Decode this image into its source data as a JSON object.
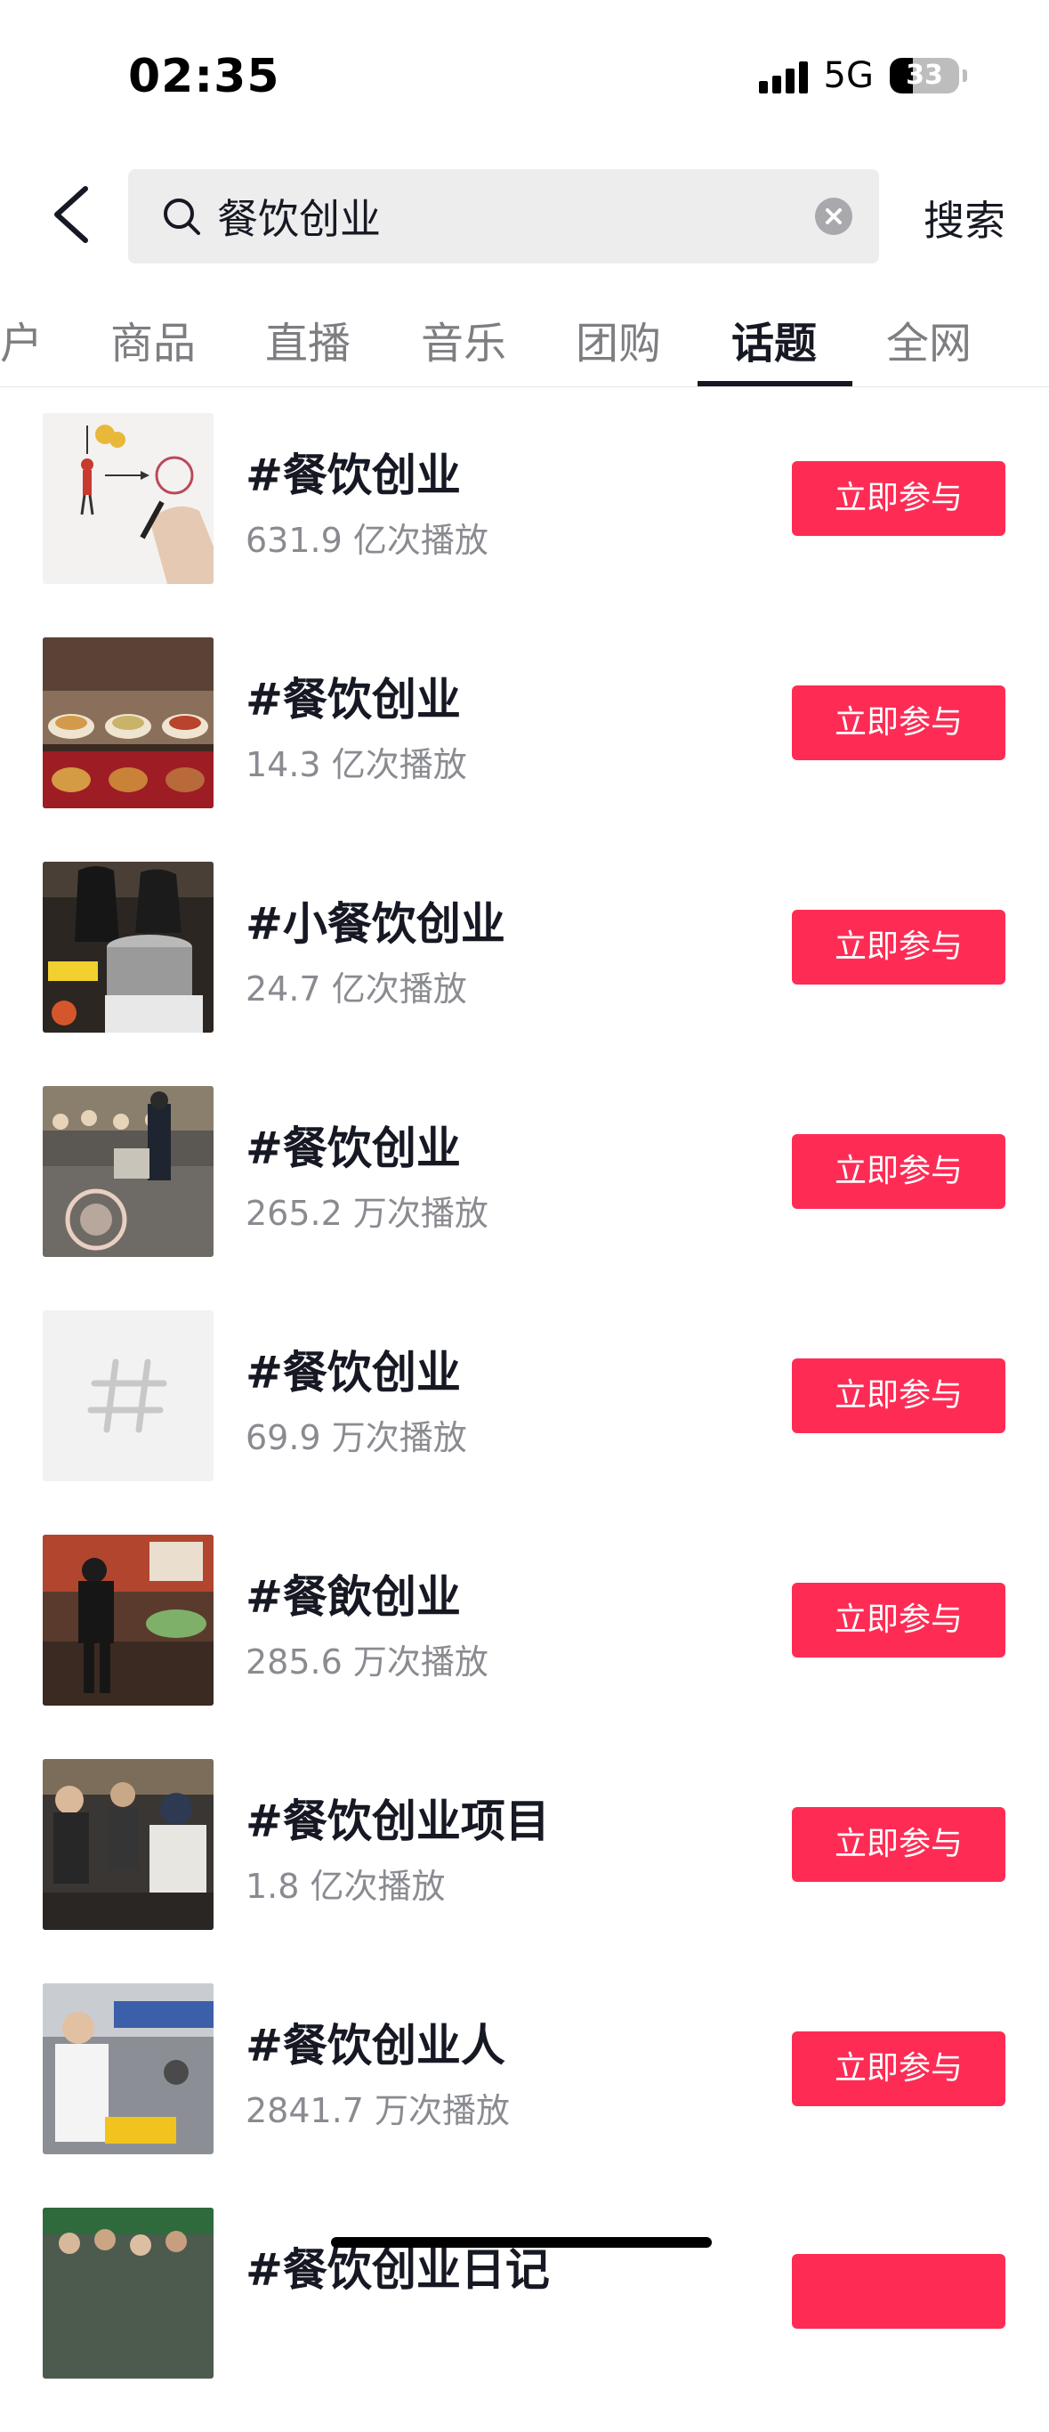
{
  "status_bar": {
    "time": "02:35",
    "network": "5G",
    "battery": "33",
    "battery_level": 0.33
  },
  "search": {
    "value": "餐饮创业",
    "submit_label": "搜索"
  },
  "tabs": [
    {
      "label": "户",
      "active": false
    },
    {
      "label": "商品",
      "active": false
    },
    {
      "label": "直播",
      "active": false
    },
    {
      "label": "音乐",
      "active": false
    },
    {
      "label": "团购",
      "active": false
    },
    {
      "label": "话题",
      "active": true
    },
    {
      "label": "全网",
      "active": false
    }
  ],
  "topics": [
    {
      "title": "#餐饮创业",
      "plays": "631.9 亿次播放",
      "button": "立即参与",
      "thumb": "drawing-pen"
    },
    {
      "title": "#餐饮创业",
      "plays": "14.3 亿次播放",
      "button": "立即参与",
      "thumb": "noodle-menu"
    },
    {
      "title": "#小餐饮创业",
      "plays": "24.7 亿次播放",
      "button": "立即参与",
      "thumb": "kitchen-pot"
    },
    {
      "title": "#餐饮创业",
      "plays": "265.2 万次播放",
      "button": "立即参与",
      "thumb": "street-crowd"
    },
    {
      "title": "#餐饮创业",
      "plays": "69.9 万次播放",
      "button": "立即参与",
      "thumb": "hashtag-placeholder"
    },
    {
      "title": "#餐飲创业",
      "plays": "285.6 万次播放",
      "button": "立即参与",
      "thumb": "shop-counter"
    },
    {
      "title": "#餐饮创业项目",
      "plays": "1.8 亿次播放",
      "button": "立即参与",
      "thumb": "people-queue"
    },
    {
      "title": "#餐饮创业人",
      "plays": "2841.7 万次播放",
      "button": "立即参与",
      "thumb": "street-vendor"
    },
    {
      "title": "#餐饮创业日记",
      "plays": "",
      "button": "",
      "thumb": "market-crowd"
    }
  ],
  "colors": {
    "accent": "#fe2c55",
    "text_primary": "#161823",
    "text_secondary": "#8a8b91"
  }
}
